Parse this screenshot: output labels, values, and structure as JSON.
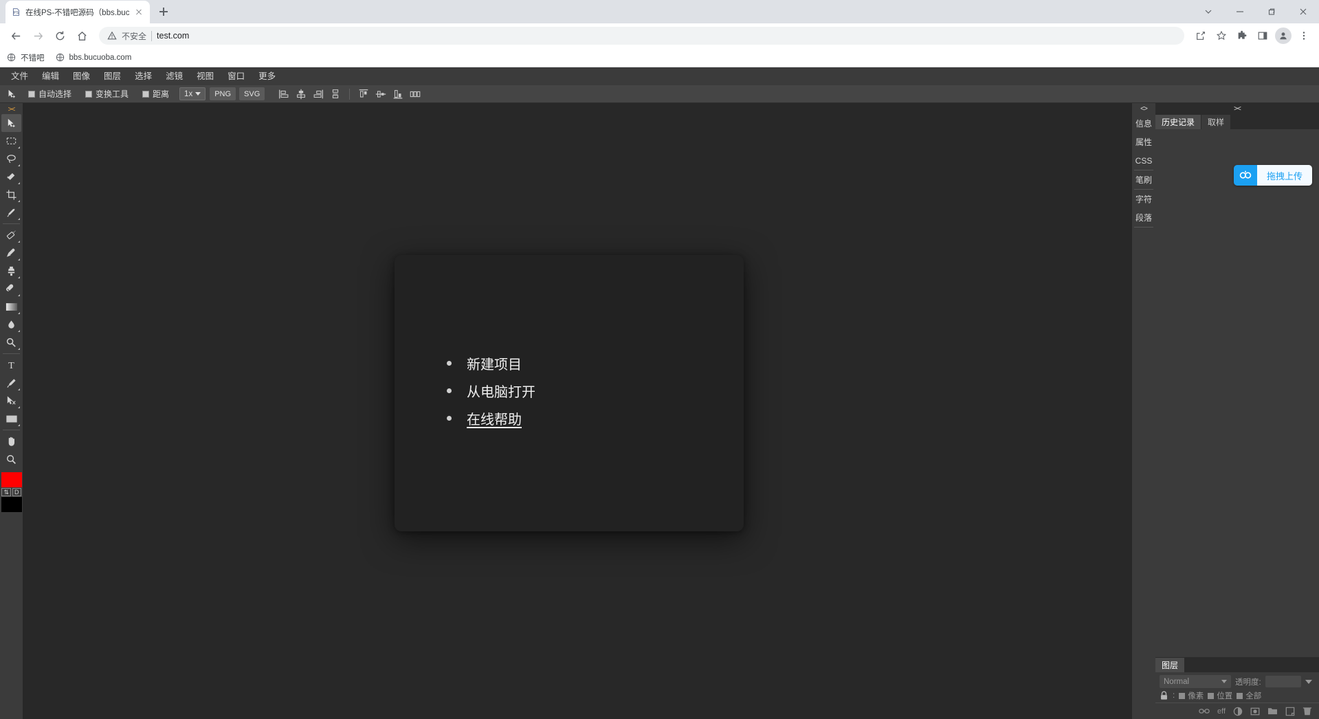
{
  "browser": {
    "tab": {
      "title": "在线PS-不错吧源码（bbs.bucuo",
      "favicon": "ps-favicon",
      "close": "close-icon"
    },
    "new_tab_label": "+",
    "window_controls": [
      "tab-search-icon",
      "minimize-icon",
      "maximize-icon",
      "close-icon"
    ],
    "nav": {
      "back": "back-arrow-icon",
      "forward": "forward-arrow-icon",
      "reload": "reload-icon",
      "home": "home-icon"
    },
    "omnibox": {
      "security_label": "不安全",
      "url": "test.com",
      "security_icon": "warning-triangle-icon"
    },
    "toolbar_icons": [
      "share-icon",
      "bookmark-star-icon",
      "extensions-icon",
      "side-panel-icon",
      "profile-avatar-icon",
      "more-menu-icon"
    ],
    "bookmarks": [
      {
        "label": "不错吧",
        "icon": "globe-icon"
      },
      {
        "label": "bbs.bucuoba.com",
        "icon": "globe-icon"
      }
    ]
  },
  "app": {
    "menubar": [
      "文件",
      "编辑",
      "图像",
      "图层",
      "选择",
      "滤镜",
      "视图",
      "窗口",
      "更多"
    ],
    "options_bar": {
      "tool_icon": "move-tool-icon",
      "checkboxes": [
        {
          "label": "自动选择",
          "checked": true
        },
        {
          "label": "变换工具",
          "checked": true
        },
        {
          "label": "距离",
          "checked": true
        }
      ],
      "zoom_select": "1x",
      "export_buttons": [
        "PNG",
        "SVG"
      ],
      "align_icons": [
        "align-left-icon",
        "align-center-horizontal-icon",
        "align-right-icon",
        "distribute-vertical-icon",
        "align-top-icon",
        "align-middle-vertical-icon",
        "align-bottom-icon",
        "distribute-horizontal-icon"
      ]
    },
    "toolbox": {
      "collapse": "><",
      "tools": [
        {
          "name": "move-tool",
          "icon": "move-tool-icon",
          "active": true
        },
        {
          "name": "marquee-tool",
          "icon": "rectangular-marquee-icon",
          "active": false
        },
        {
          "name": "lasso-tool",
          "icon": "lasso-icon",
          "active": false
        },
        {
          "name": "quick-selection-tool",
          "icon": "magic-wand-icon",
          "active": false
        },
        {
          "name": "crop-tool",
          "icon": "crop-icon",
          "active": false
        },
        {
          "name": "eyedropper-tool",
          "icon": "eyedropper-icon",
          "active": false
        },
        {
          "name": "healing-brush-tool",
          "icon": "healing-brush-icon",
          "active": false
        },
        {
          "name": "brush-tool",
          "icon": "paintbrush-icon",
          "active": false
        },
        {
          "name": "clone-stamp-tool",
          "icon": "clone-stamp-icon",
          "active": false
        },
        {
          "name": "eraser-tool",
          "icon": "eraser-icon",
          "active": false
        },
        {
          "name": "gradient-tool",
          "icon": "gradient-icon",
          "active": false
        },
        {
          "name": "blur-tool",
          "icon": "water-drop-icon",
          "active": false
        },
        {
          "name": "dodge-tool",
          "icon": "dodge-icon",
          "active": false
        },
        {
          "name": "type-tool",
          "icon": "text-t-icon",
          "active": false
        },
        {
          "name": "pen-tool",
          "icon": "pen-icon",
          "active": false
        },
        {
          "name": "path-selection-tool",
          "icon": "path-select-icon",
          "active": false
        },
        {
          "name": "shape-tool",
          "icon": "rectangle-shape-icon",
          "active": false
        },
        {
          "name": "hand-tool",
          "icon": "hand-icon",
          "active": false
        },
        {
          "name": "zoom-tool",
          "icon": "magnifier-icon",
          "active": false
        }
      ],
      "swatches": {
        "foreground": "#ff0000",
        "background": "#000000",
        "swap_label": "⇅",
        "default_label": "D"
      }
    },
    "start_modal": {
      "items": [
        {
          "label": "新建项目",
          "underline": false
        },
        {
          "label": "从电脑打开",
          "underline": false
        },
        {
          "label": "在线帮助",
          "underline": true
        }
      ]
    },
    "right_vtabs": {
      "collapse": "<>",
      "groups": [
        [
          "信息",
          "属性",
          "CSS"
        ],
        [
          "笔刷"
        ],
        [
          "字符",
          "段落"
        ]
      ]
    },
    "history_panel": {
      "collapse": "><",
      "tabs": [
        {
          "label": "历史记录",
          "active": true
        },
        {
          "label": "取样",
          "active": false
        }
      ],
      "upload_button": {
        "label": "拖拽上传",
        "icon": "cloud-upload-icon",
        "accent": "#1ba0f2"
      }
    },
    "layers_panel": {
      "tabs": [
        {
          "label": "图层",
          "active": true
        }
      ],
      "blend_mode": "Normal",
      "opacity_label": "透明度:",
      "opacity_value": "",
      "lock_label": ":",
      "lock_options": [
        {
          "label": "像素"
        },
        {
          "label": "位置"
        },
        {
          "label": "全部"
        }
      ],
      "footer_icons": [
        "link-layers-icon",
        "layer-effects-icon",
        "adjustment-layer-icon",
        "layer-mask-icon",
        "new-group-icon",
        "new-layer-icon",
        "delete-layer-icon"
      ],
      "footer_eff_label": "eff"
    }
  },
  "colors": {
    "app_bg": "#2b2b2b",
    "panel_bg": "#3b3b3b",
    "canvas_bg": "#282828",
    "modal_bg": "#222222",
    "accent_blue": "#1ba0f2",
    "foreground_swatch": "#ff0000"
  }
}
